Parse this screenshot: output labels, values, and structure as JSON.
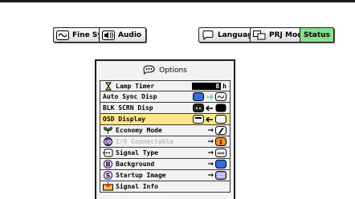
{
  "toolbar": {
    "fine_sync": "Fine Sync",
    "audio": "Audio",
    "language": "Language",
    "prj_mode": "PRJ Mode",
    "status": "Status"
  },
  "menu": {
    "title": "Options",
    "lamp_timer": {
      "label": "Lamp Timer",
      "value": "8",
      "unit": "h"
    },
    "auto_sync": {
      "label": "Auto Sync Disp"
    },
    "blk_scrn": {
      "label": "BLK SCRN Disp"
    },
    "osd": {
      "label": "OSD Display"
    },
    "economy": {
      "label": "Economy Mode"
    },
    "io_connect": {
      "label": "I/O Connectable"
    },
    "signal_type": {
      "label": "Signal Type"
    },
    "background": {
      "label": "Background"
    },
    "startup": {
      "label": "Startup Image"
    },
    "signal_info": {
      "label": "Signal Info"
    }
  },
  "colors": {
    "status_green": "#86e08d",
    "selected_row": "#ffe68a",
    "accent_blue": "#2f6fe0"
  }
}
